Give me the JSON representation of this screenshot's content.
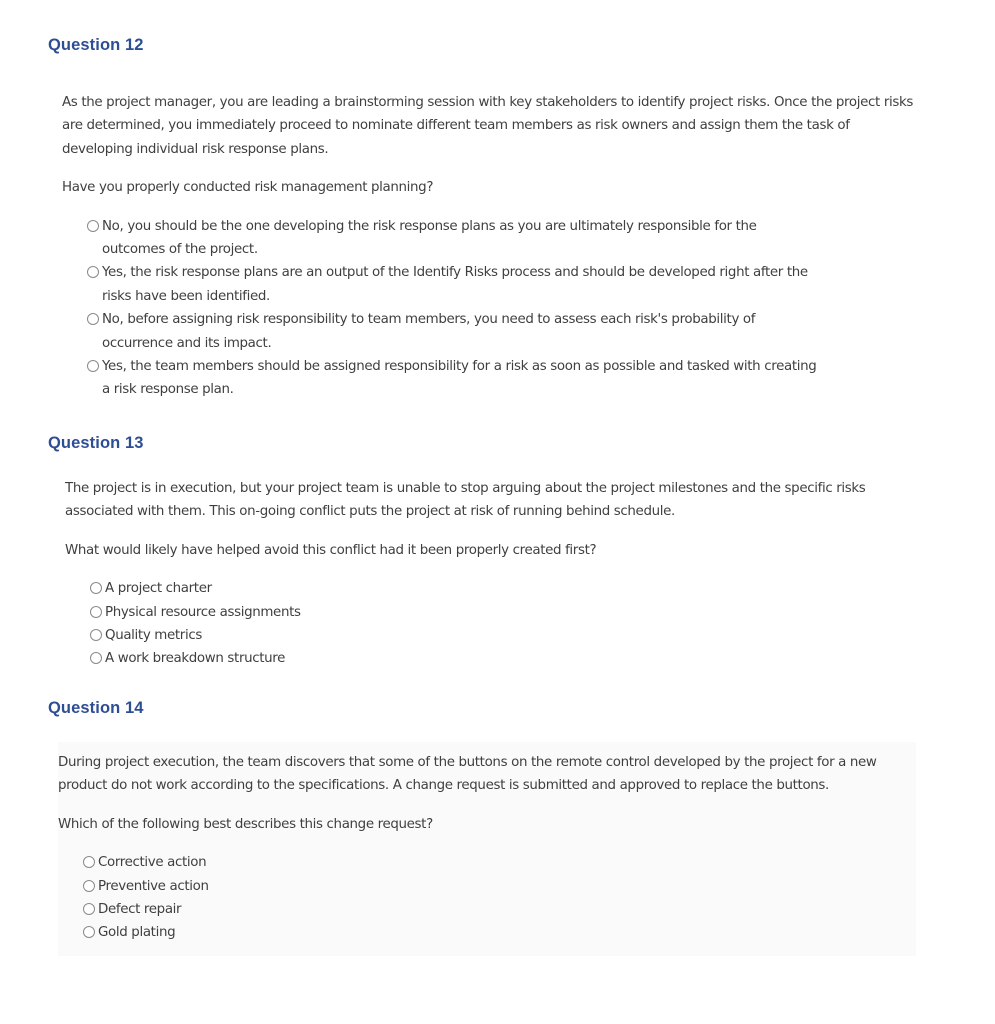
{
  "questions": [
    {
      "heading": "Question 12",
      "scenario": "As the project manager, you are leading a brainstorming session with key stakeholders to identify project risks. Once the project risks are determined, you immediately proceed to nominate different team members as risk owners and assign them the task of developing individual risk response plans.",
      "prompt": "Have you properly conducted risk management planning?",
      "options": [
        {
          "label": "No, you should be the one developing the risk response plans as you are ultimately responsible for the outcomes of the project.",
          "selected": false
        },
        {
          "label": "Yes, the risk response plans are an output of the Identify Risks process and should be developed right after the risks have been identified.",
          "selected": false
        },
        {
          "label": "No, before assigning risk responsibility to team members, you need to assess each risk's probability of occurrence and its impact.",
          "selected": false
        },
        {
          "label": "Yes, the team members should be assigned responsibility for a risk as soon as possible and tasked with creating a risk response plan.",
          "selected": false
        }
      ]
    },
    {
      "heading": "Question 13",
      "scenario": "The project is in execution, but your project team is unable to stop arguing about the project milestones and the specific risks associated with them. This on-going conflict puts the project at risk of running behind schedule.",
      "prompt": "What would likely have helped avoid this conflict had it been properly created first?",
      "options": [
        {
          "label": "A project charter",
          "selected": false
        },
        {
          "label": "Physical resource assignments",
          "selected": false
        },
        {
          "label": "Quality metrics",
          "selected": false
        },
        {
          "label": "A work breakdown structure",
          "selected": false
        }
      ]
    },
    {
      "heading": "Question 14",
      "scenario": "During project execution, the team discovers that some of the buttons on the remote control developed by the project for a new product do not work according to the specifications. A change request is submitted and approved to replace the buttons.",
      "prompt": "Which of the following best describes this change request?",
      "options": [
        {
          "label": "Corrective action",
          "selected": false
        },
        {
          "label": "Preventive action",
          "selected": false
        },
        {
          "label": "Defect repair",
          "selected": false
        },
        {
          "label": "Gold plating",
          "selected": false
        }
      ]
    }
  ],
  "colors": {
    "heading": "#2e4e94",
    "body_text": "#3f3f3f",
    "panel_background": "#fafafa",
    "radio_border": "#8a8a8a"
  }
}
